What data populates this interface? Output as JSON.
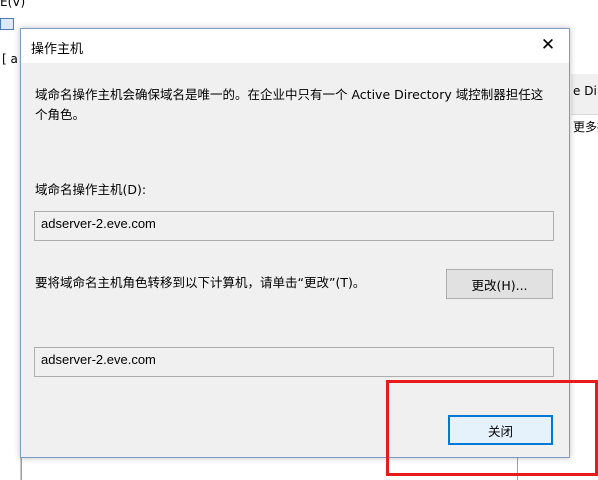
{
  "background": {
    "menu_fragment": "E(V)",
    "left_fragment": "[ a",
    "right_fragment_1": "e Di",
    "right_fragment_2": "更多控"
  },
  "dialog": {
    "title": "操作主机",
    "close_glyph": "✕",
    "description": "域命名操作主机会确保域名是唯一的。在企业中只有一个 Active Directory 域控制器担任这个角色。",
    "fsmo_label": "域命名操作主机(D):",
    "current_master": "adserver-2.eve.com",
    "transfer_text": "要将域命名主机角色转移到以下计算机，请单击“更改”(T)。",
    "change_button": "更改(H)...",
    "target_computer": "adserver-2.eve.com",
    "close_button": "关闭"
  },
  "colors": {
    "annotation": "#e81a1a",
    "dialog_border": "#7a9cc6",
    "default_button_border": "#0078d7"
  }
}
